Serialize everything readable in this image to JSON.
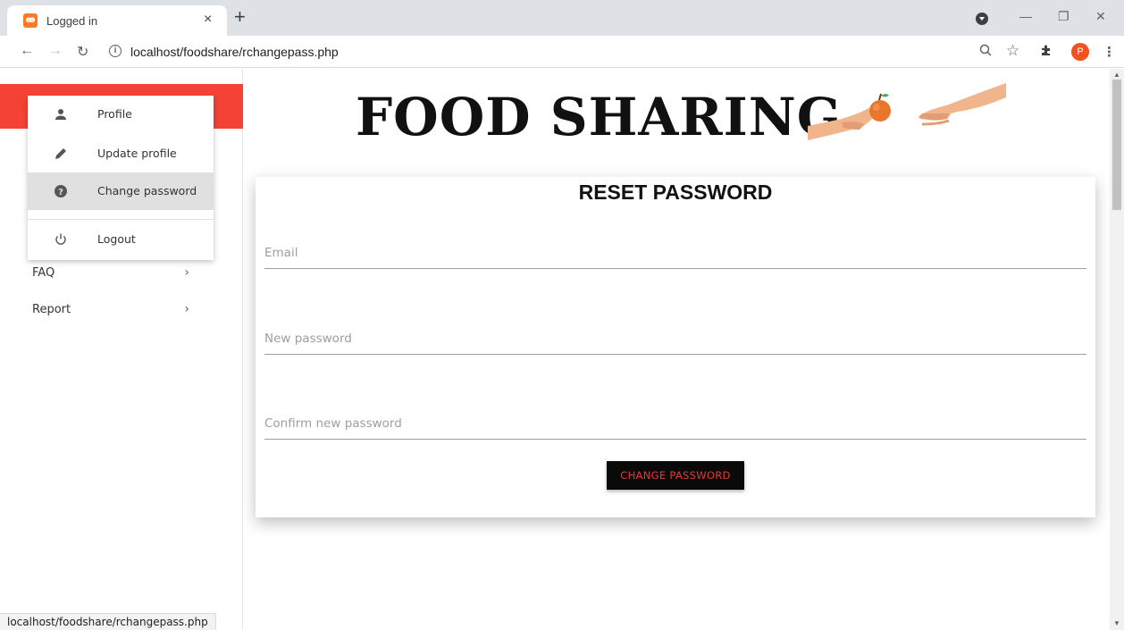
{
  "browser": {
    "tab_title": "Logged in",
    "tab_close": "×",
    "new_tab": "+",
    "url": "localhost/foodshare/rchangepass.php",
    "profile_initial": "P",
    "status_url": "localhost/foodshare/rchangepass.php"
  },
  "sidebar": {
    "items": [
      {
        "label": "FAQ"
      },
      {
        "label": "Report"
      }
    ],
    "chevron": "›"
  },
  "dropdown": {
    "items": [
      {
        "label": "Profile",
        "icon": "person-icon"
      },
      {
        "label": "Update profile",
        "icon": "pencil-icon"
      },
      {
        "label": "Change password",
        "icon": "help-circle-icon",
        "active": true
      },
      {
        "label": "Logout",
        "icon": "power-icon"
      }
    ]
  },
  "header": {
    "brand": "FOOD SHARING"
  },
  "form": {
    "title": "RESET PASSWORD",
    "email_placeholder": "Email",
    "new_password_placeholder": "New password",
    "confirm_password_placeholder": "Confirm new password",
    "submit_label": "CHANGE PASSWORD"
  },
  "colors": {
    "accent": "#f44336",
    "button_bg": "#0a0a0a",
    "button_text": "#e53935"
  }
}
